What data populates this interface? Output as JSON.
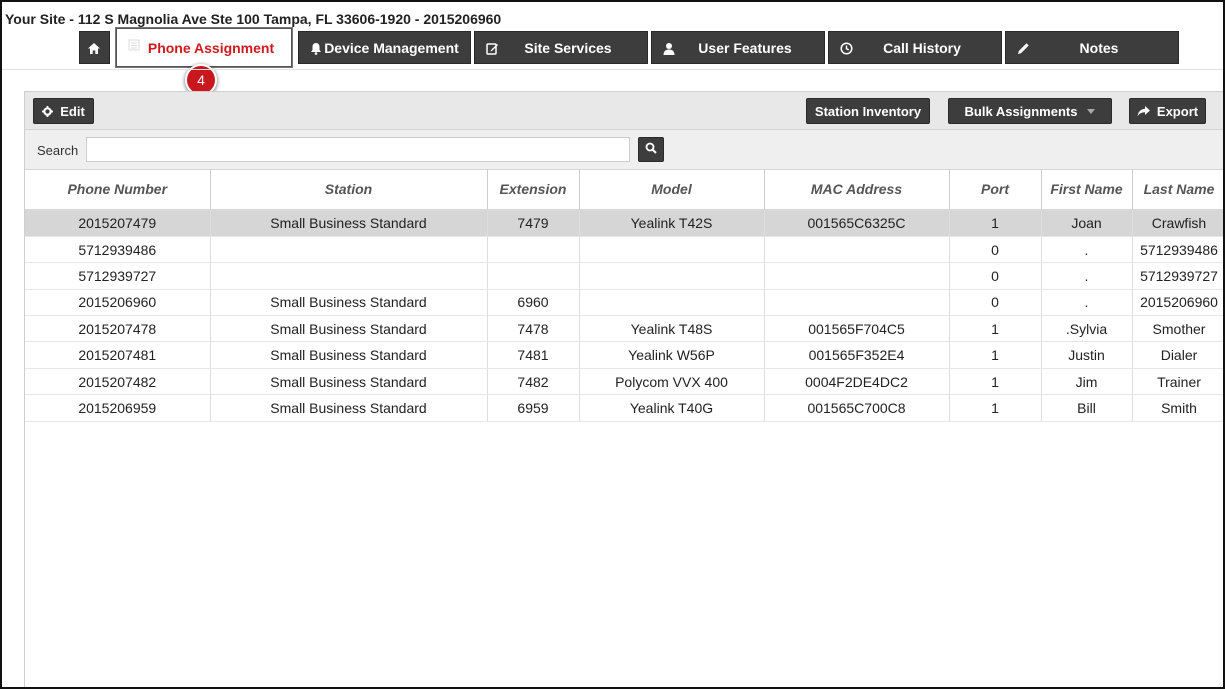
{
  "site": {
    "title": "Your Site - 112 S Magnolia Ave Ste 100 Tampa, FL 33606-1920 - 2015206960"
  },
  "tabs": {
    "home": {
      "icon": "home-icon"
    },
    "phone_assignment": {
      "label": "Phone Assignment",
      "icon": "phone-list-icon",
      "active": true
    },
    "device_management": {
      "label": "Device Management",
      "icon": "bell-icon"
    },
    "site_services": {
      "label": "Site Services",
      "icon": "edit-icon"
    },
    "user_features": {
      "label": "User Features",
      "icon": "user-icon"
    },
    "call_history": {
      "label": "Call History",
      "icon": "clock-icon"
    },
    "notes": {
      "label": "Notes",
      "icon": "pencil-icon"
    }
  },
  "step_marker": {
    "label": "4"
  },
  "toolbar": {
    "edit_label": "Edit",
    "station_inventory_label": "Station Inventory",
    "bulk_assignments_label": "Bulk Assignments",
    "export_label": "Export"
  },
  "search": {
    "label": "Search",
    "value": "",
    "placeholder": ""
  },
  "table": {
    "columns": [
      "Phone Number",
      "Station",
      "Extension",
      "Model",
      "MAC Address",
      "Port",
      "First Name",
      "Last Name"
    ],
    "rows": [
      {
        "phone": "2015207479",
        "station": "Small Business Standard",
        "extension": "7479",
        "model": "Yealink T42S",
        "mac": "001565C6325C",
        "port": "1",
        "first": "Joan",
        "last": "Crawfish",
        "selected": true
      },
      {
        "phone": "5712939486",
        "station": "",
        "extension": "",
        "model": "",
        "mac": "",
        "port": "0",
        "first": ".",
        "last": "5712939486"
      },
      {
        "phone": "5712939727",
        "station": "",
        "extension": "",
        "model": "",
        "mac": "",
        "port": "0",
        "first": ".",
        "last": "5712939727"
      },
      {
        "phone": "2015206960",
        "station": "Small Business Standard",
        "extension": "6960",
        "model": "",
        "mac": "",
        "port": "0",
        "first": ".",
        "last": "2015206960"
      },
      {
        "phone": "2015207478",
        "station": "Small Business Standard",
        "extension": "7478",
        "model": "Yealink T48S",
        "mac": "001565F704C5",
        "port": "1",
        "first": ".Sylvia",
        "last": "Smother"
      },
      {
        "phone": "2015207481",
        "station": "Small Business Standard",
        "extension": "7481",
        "model": "Yealink W56P",
        "mac": "001565F352E4",
        "port": "1",
        "first": "Justin",
        "last": "Dialer"
      },
      {
        "phone": "2015207482",
        "station": "Small Business Standard",
        "extension": "7482",
        "model": "Polycom VVX 400",
        "mac": "0004F2DE4DC2",
        "port": "1",
        "first": "Jim",
        "last": "Trainer"
      },
      {
        "phone": "2015206959",
        "station": "Small Business Standard",
        "extension": "6959",
        "model": "Yealink T40G",
        "mac": "001565C700C8",
        "port": "1",
        "first": "Bill",
        "last": "Smith"
      }
    ]
  },
  "colors": {
    "accent_red": "#d0191e",
    "dark_button": "#3d3d3d",
    "selected_row": "#d6d6d6"
  }
}
